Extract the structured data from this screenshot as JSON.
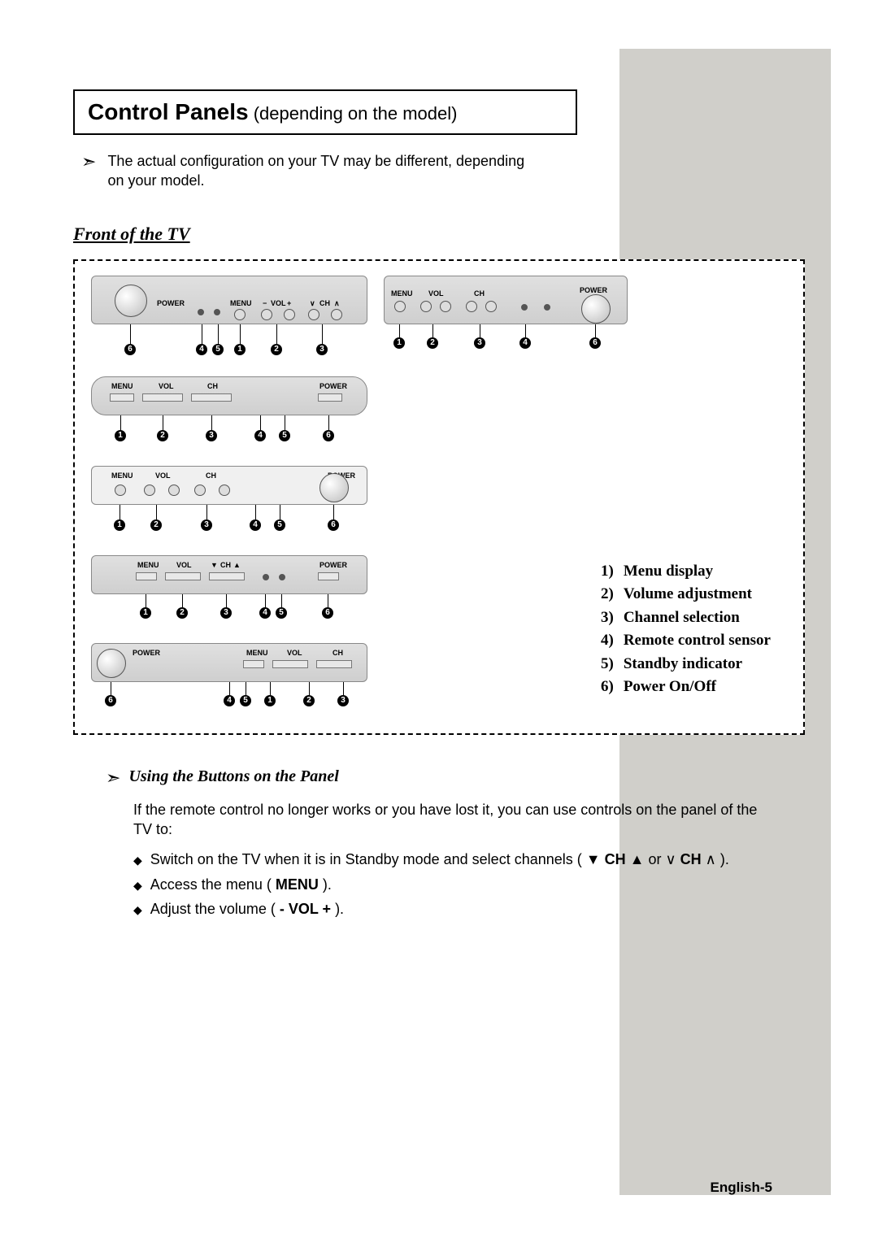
{
  "title": {
    "strong": "Control Panels",
    "light": " (depending on the model)"
  },
  "note": "The actual configuration on your TV may be different, depending on your model.",
  "front_heading": "Front of the TV",
  "panel_labels": {
    "power": "POWER",
    "menu": "MENU",
    "vol_minus": "−",
    "vol": "VOL",
    "vol_plus": "+",
    "ch_down_v": "∨",
    "ch": "CH",
    "ch_up_caret": "∧",
    "ch_down_tri": "▼",
    "ch_up_tri": "▲"
  },
  "callouts": {
    "1": "1",
    "2": "2",
    "3": "3",
    "4": "4",
    "5": "5",
    "6": "6"
  },
  "legend": [
    {
      "n": "1)",
      "t": "Menu display"
    },
    {
      "n": "2)",
      "t": "Volume adjustment"
    },
    {
      "n": "3)",
      "t": "Channel selection"
    },
    {
      "n": "4)",
      "t": "Remote control sensor"
    },
    {
      "n": "5)",
      "t": "Standby indicator"
    },
    {
      "n": "6)",
      "t": "Power On/Off"
    }
  ],
  "using_heading": "Using the Buttons on the Panel",
  "using_intro": "If the remote control no longer works or you have lost it, you can use controls on the panel of the TV to:",
  "bullets": {
    "b1_a": "Switch on the TV when it is in Standby mode and select channels ( ",
    "b1_b": " CH ",
    "b1_c": " or ",
    "b1_d": " CH ",
    "b1_e": " ).",
    "b2_a": "Access the menu ( ",
    "b2_b": "MENU",
    "b2_c": " ).",
    "b3_a": "Adjust the volume ( ",
    "b3_b": "- VOL +",
    "b3_c": " )."
  },
  "page_number": "English-5"
}
